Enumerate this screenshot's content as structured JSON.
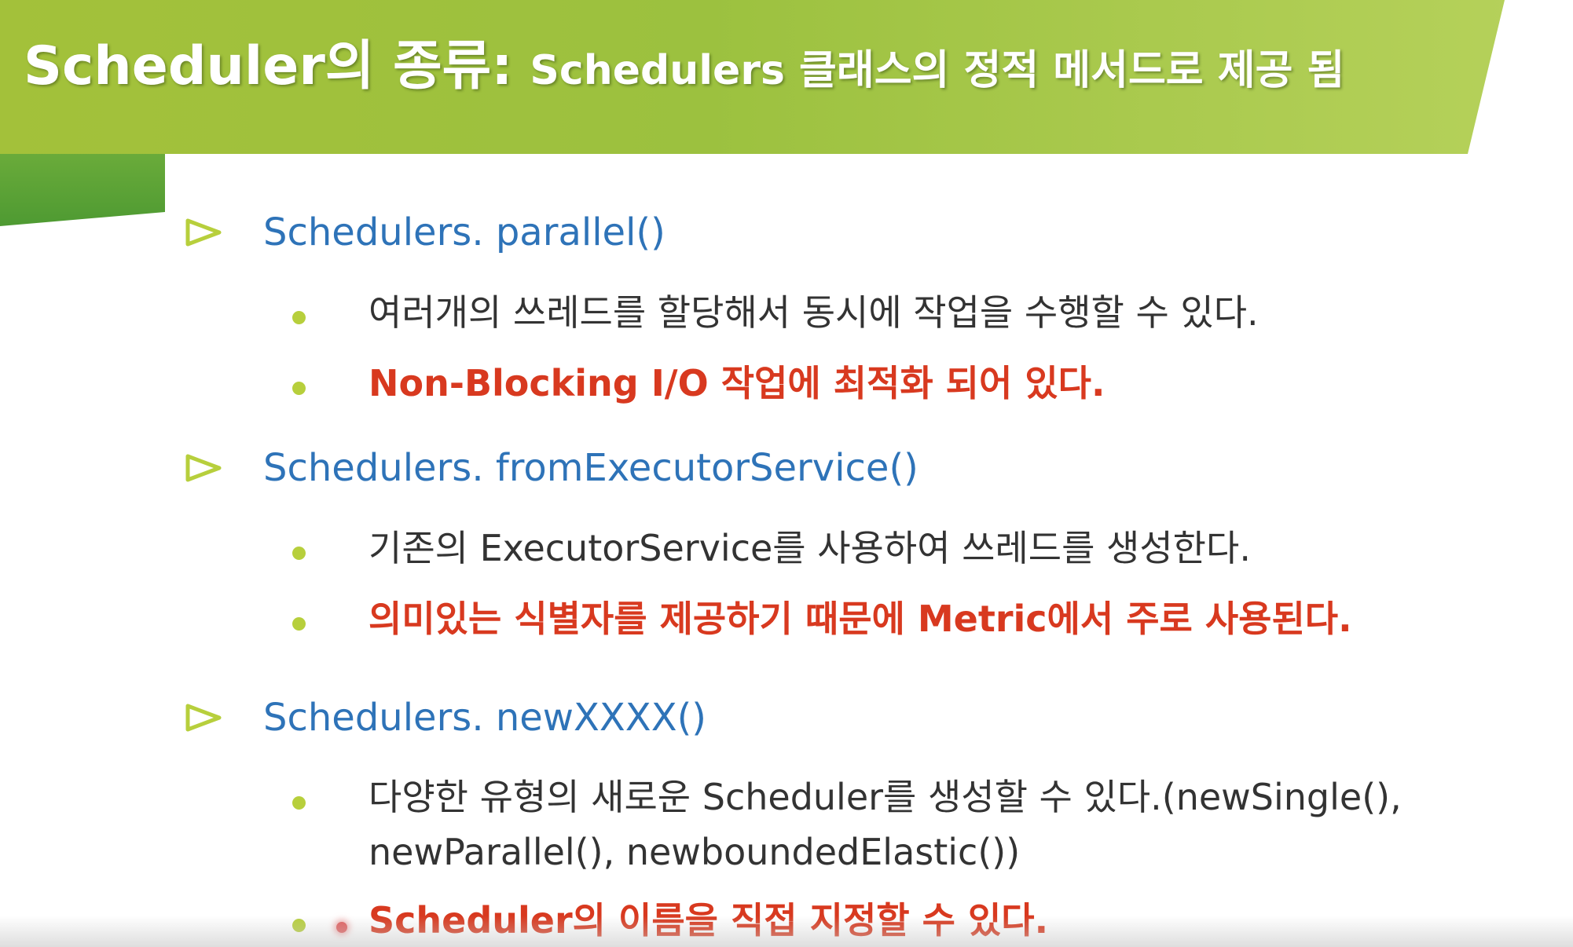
{
  "slide": {
    "title_main": "Scheduler의 종류:",
    "title_sub": "Schedulers 클래스의 정적 메서드로 제공 됨",
    "sections": [
      {
        "heading": "Schedulers. parallel()",
        "bullets": [
          "여러개의 쓰레드를 할당해서 동시에 작업을 수행할 수 있다.",
          "Non-Blocking I/O 작업에 최적화 되어 있다."
        ]
      },
      {
        "heading": "Schedulers. fromExecutorService()",
        "bullets": [
          "기존의 ExecutorService를 사용하여 쓰레드를 생성한다.",
          "의미있는 식별자를 제공하기 때문에 Metric에서 주로 사용된다."
        ]
      },
      {
        "heading": "Schedulers. newXXXX()",
        "bullets": [
          "다양한 유형의 새로운 Scheduler를 생성할 수 있다.(newSingle(),",
          "newParallel(), newboundedElastic())",
          "Scheduler의 이름을 직접 지정할 수 있다."
        ]
      }
    ]
  },
  "colors": {
    "header_green": "#a3c13a",
    "wedge_green": "#4e9a32",
    "heading_blue": "#2e73b8",
    "bullet_dot": "#b7cf3c",
    "highlight_red": "#d8391f",
    "body_text": "#333333"
  },
  "icons": {
    "section_marker": "triangle-outline-icon",
    "bullet_marker": "bullet-dot-icon"
  }
}
